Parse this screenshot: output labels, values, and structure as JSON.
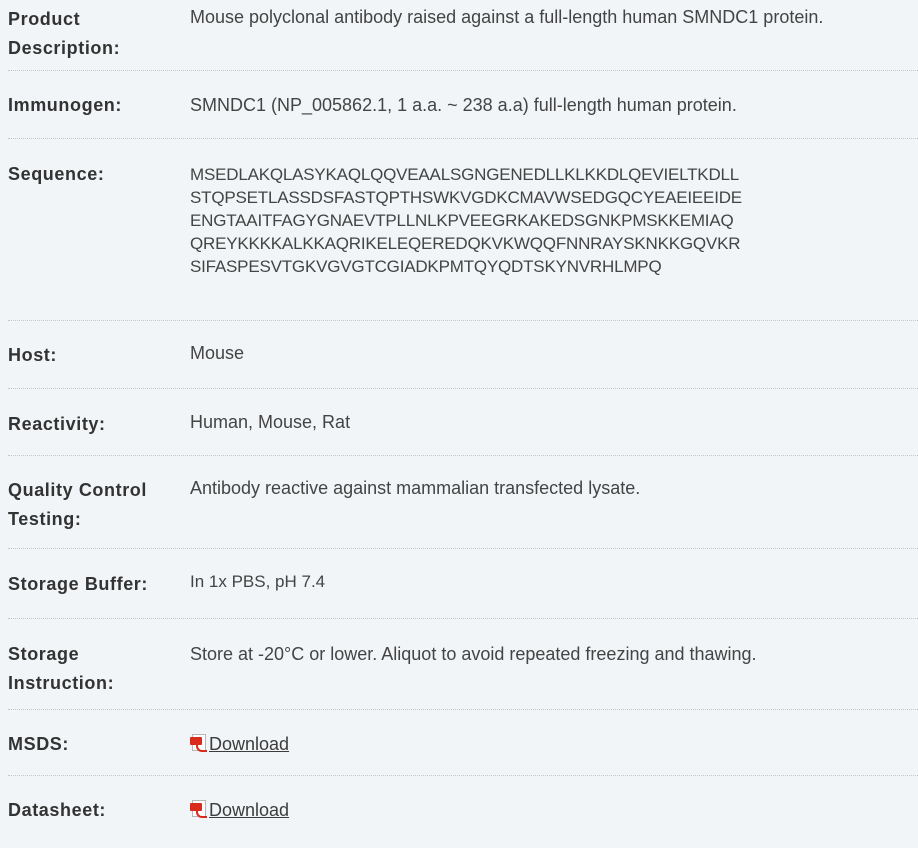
{
  "rows": [
    {
      "label": "Product Description:",
      "value": "Mouse polyclonal antibody raised against a full-length human SMNDC1 protein."
    },
    {
      "label": "Immunogen:",
      "value": "SMNDC1 (NP_005862.1, 1 a.a. ~ 238 a.a) full-length human protein."
    },
    {
      "label": "Sequence:",
      "lines": [
        "MSEDLAKQLASYKAQLQQVEAALSGNGENEDLLKLKKDLQEVIELTKDLL",
        "STQPSETLASSDSFASTQPTHSWKVGDKCMAVWSEDGQCYEAEIEEIDE",
        "ENGTAAITFAGYGNAEVTPLLNLKPVEEGRKAKEDSGNKPMSKKEMIAQ",
        "QREYKKKKALKKAQRIKELEQEREDQKVKWQQFNNRAYSKNKKGQVKR",
        "SIFASPESVTGKVGVGTCGIADKPMTQYQDTSKYNVRHLMPQ"
      ]
    },
    {
      "label": "Host:",
      "value": "Mouse"
    },
    {
      "label": "Reactivity:",
      "value": "Human, Mouse, Rat"
    },
    {
      "label": "Quality Control Testing:",
      "value": "Antibody reactive against mammalian transfected lysate."
    },
    {
      "label": "Storage Buffer:",
      "value": "In 1x PBS, pH 7.4"
    },
    {
      "label": "Storage Instruction:",
      "value": "Store at -20°C or lower. Aliquot to avoid repeated freezing and thawing."
    },
    {
      "label": "MSDS:",
      "link": "Download",
      "icon": "pdf-icon"
    },
    {
      "label": "Datasheet:",
      "link": "Download",
      "icon": "pdf-icon"
    }
  ],
  "colors": {
    "background": "#f1f5f7",
    "text": "#3c3c3c",
    "divider": "#c7c7c7",
    "pdf_red": "#d92a1e"
  }
}
